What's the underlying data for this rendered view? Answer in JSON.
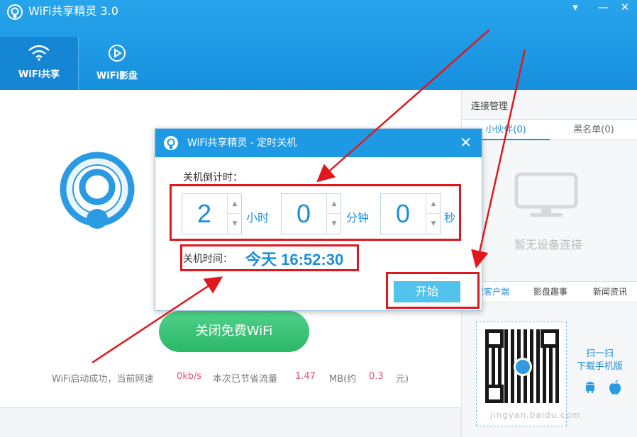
{
  "app": {
    "title": "WiFi共享精灵 3.0",
    "menu_glyph": "▾",
    "minimize_glyph": "—",
    "close_glyph": "✕"
  },
  "nav": {
    "tabs": [
      {
        "label": "WiFi共享"
      },
      {
        "label": "WiFi影盘"
      }
    ]
  },
  "main": {
    "wifi_button_label": "关闭免费WiFi",
    "status": {
      "prefix": "WiFi启动成功，当前网速",
      "speed": "0kb/s",
      "saved_label": "本次已节省流量",
      "saved_value": "1.47",
      "unit_about": "MB(约",
      "money": "0.3",
      "currency": "元)"
    }
  },
  "right": {
    "title": "连接管理",
    "tabs": [
      {
        "label": "小伙伴(0)"
      },
      {
        "label": "黑名单(0)"
      }
    ],
    "empty_text": "暂无设备连接",
    "bottom_tabs": [
      {
        "label": "载客户端"
      },
      {
        "label": "影盘趣事"
      },
      {
        "label": "新闻资讯"
      }
    ],
    "scan_line1": "扫一扫",
    "scan_line2": "下载手机版",
    "watermark": "jingyan.baidu.com"
  },
  "dialog": {
    "title": "WiFi共享精灵 - 定时关机",
    "close_glyph": "✕",
    "countdown_label": "关机倒计时：",
    "hours": "2",
    "hours_unit": "小时",
    "minutes": "0",
    "minutes_unit": "分钟",
    "seconds": "0",
    "seconds_unit": "秒",
    "shutdown_label": "关机时间：",
    "shutdown_time": "今天 16:52:30",
    "start_label": "开始",
    "arrow_up": "▲",
    "arrow_down": "▼"
  },
  "colors": {
    "header": "#1e9ae4",
    "accent": "#1a8fdc",
    "green": "#2bb867",
    "annotation": "#e0171d"
  }
}
